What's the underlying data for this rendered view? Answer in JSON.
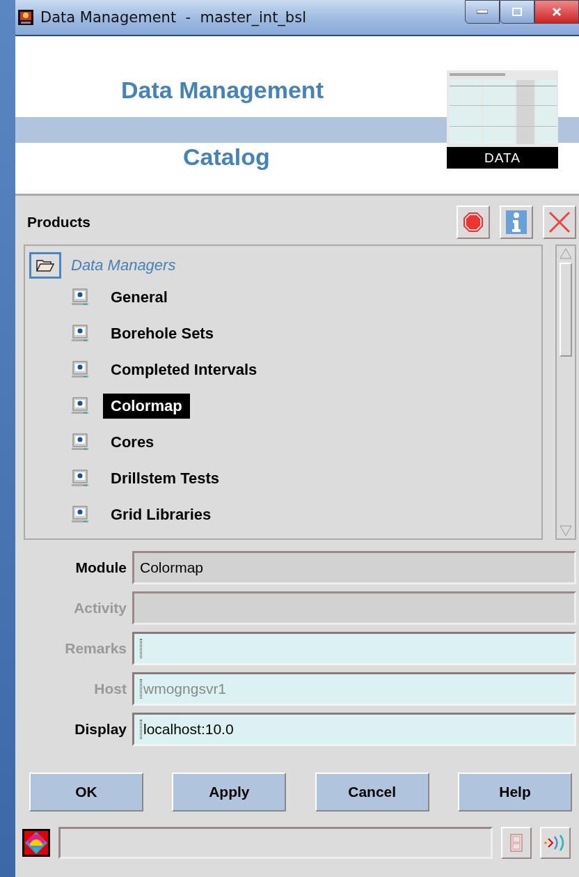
{
  "window": {
    "title": "Data Management  -  master_int_bsl"
  },
  "header": {
    "title": "Data Management",
    "subtitle": "Catalog",
    "logo_text": "DATA"
  },
  "products": {
    "label": "Products",
    "tree": [
      {
        "label": "Data Managers",
        "expanded": true,
        "selected": false,
        "children": [
          {
            "label": "General",
            "selected": false
          },
          {
            "label": "Borehole Sets",
            "selected": false
          },
          {
            "label": "Completed Intervals",
            "selected": false
          },
          {
            "label": "Colormap",
            "selected": true
          },
          {
            "label": "Cores",
            "selected": false
          },
          {
            "label": "Drillstem Tests",
            "selected": false
          },
          {
            "label": "Grid Libraries",
            "selected": false
          }
        ]
      }
    ]
  },
  "fields": [
    {
      "label": "Module",
      "value": "Colormap",
      "disabled": false,
      "editable": false
    },
    {
      "label": "Activity",
      "disabled": true,
      "editable": false
    },
    {
      "label": "Remarks",
      "disabled": true,
      "editable": true
    },
    {
      "label": "Host",
      "value": "wmogngsvr1",
      "disabled": true,
      "editable": true
    },
    {
      "label": "Display",
      "value": "localhost:10.0",
      "disabled": false,
      "editable": true
    }
  ],
  "buttons": [
    "OK",
    "Apply",
    "Cancel",
    "Help"
  ]
}
